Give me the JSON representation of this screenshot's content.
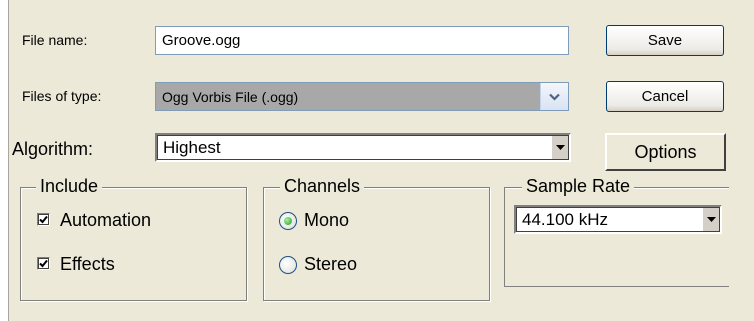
{
  "file_name": {
    "label": "File name:",
    "value": "Groove.ogg"
  },
  "file_type": {
    "label": "Files of type:",
    "value": "Ogg Vorbis File (.ogg)"
  },
  "algorithm": {
    "label": "Algorithm:",
    "value": "Highest"
  },
  "buttons": {
    "save": "Save",
    "cancel": "Cancel",
    "options": "Options"
  },
  "include": {
    "legend": "Include",
    "automation": {
      "label": "Automation",
      "checked": true
    },
    "effects": {
      "label": "Effects",
      "checked": true
    }
  },
  "channels": {
    "legend": "Channels",
    "mono": {
      "label": "Mono",
      "selected": true
    },
    "stereo": {
      "label": "Stereo",
      "selected": false
    }
  },
  "sample_rate": {
    "legend": "Sample Rate",
    "value": "44.100 kHz"
  },
  "colors": {
    "panel_bg": "#ece9d8",
    "xp_border": "#003c74",
    "field_border": "#7f9db9",
    "radio_dot": "#21a121"
  },
  "icons": {
    "dropdown": "chevron-down-icon",
    "check": "checkmark-icon",
    "radio": "radio-dot-icon"
  }
}
